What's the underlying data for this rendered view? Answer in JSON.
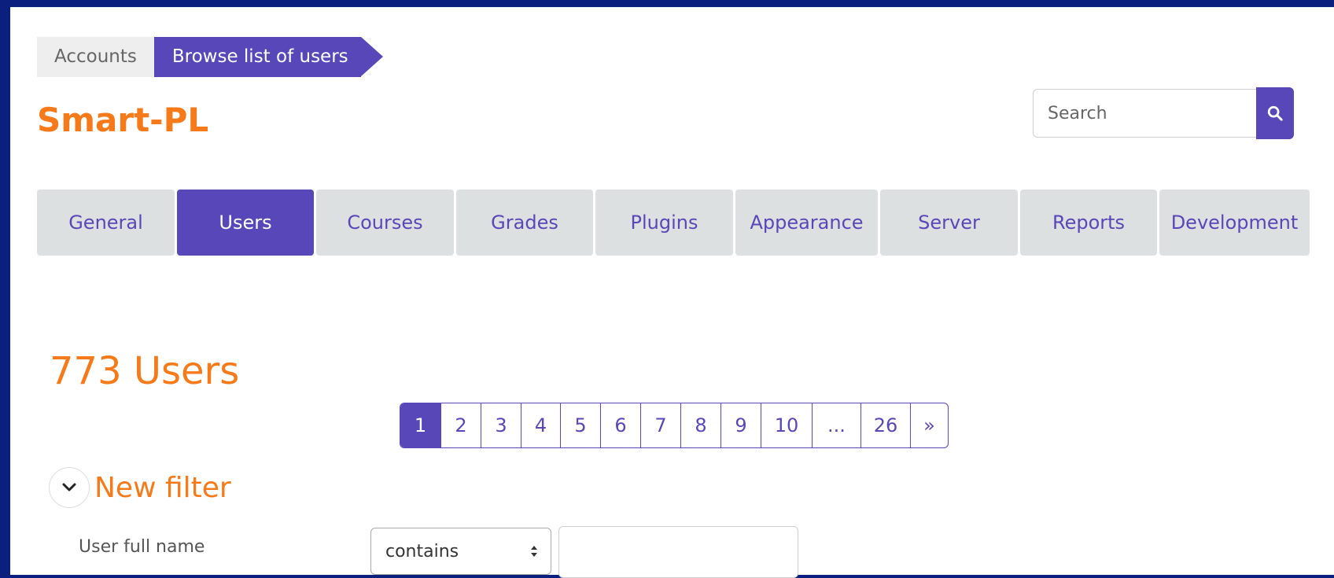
{
  "breadcrumb": {
    "items": [
      "Accounts",
      "Browse list of users"
    ]
  },
  "site": {
    "title": "Smart-PL"
  },
  "search": {
    "placeholder": "Search",
    "icon": "search-icon"
  },
  "tabs": [
    {
      "label": "General"
    },
    {
      "label": "Users",
      "active": true
    },
    {
      "label": "Courses"
    },
    {
      "label": "Grades"
    },
    {
      "label": "Plugins"
    },
    {
      "label": "Appearance"
    },
    {
      "label": "Server"
    },
    {
      "label": "Reports"
    },
    {
      "label": "Development"
    }
  ],
  "main": {
    "heading": "773 Users"
  },
  "pagination": {
    "pages": [
      "1",
      "2",
      "3",
      "4",
      "5",
      "6",
      "7",
      "8",
      "9",
      "10",
      "...",
      "26",
      "»"
    ],
    "current": "1"
  },
  "filter": {
    "title": "New filter",
    "field_label": "User full name",
    "operator": "contains",
    "value": ""
  },
  "colors": {
    "background": "#0b1f7e",
    "primary": "#5747b8",
    "accent": "#f67a1a",
    "tab_bg": "#dde0e0"
  }
}
